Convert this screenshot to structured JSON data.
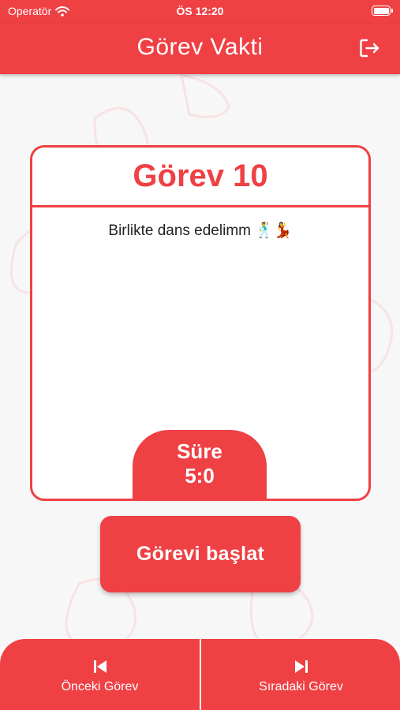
{
  "status_bar": {
    "carrier": "Operatör",
    "time": "ÖS 12:20",
    "battery_level": 1.0
  },
  "app_bar": {
    "title": "Görev Vakti",
    "logout_icon": "logout-icon"
  },
  "task": {
    "title": "Görev 10",
    "text": "Birlikte dans edelimm 🕺💃"
  },
  "timer": {
    "label": "Süre",
    "value": "5:0"
  },
  "actions": {
    "start_label": "Görevi başlat"
  },
  "bottom_nav": {
    "prev_label": "Önceki Görev",
    "prev_icon": "skip-previous-icon",
    "next_label": "Sıradaki Görev",
    "next_icon": "skip-next-icon"
  },
  "colors": {
    "primary": "#ef4044",
    "background": "#f7f7f7",
    "text": "#222222"
  }
}
